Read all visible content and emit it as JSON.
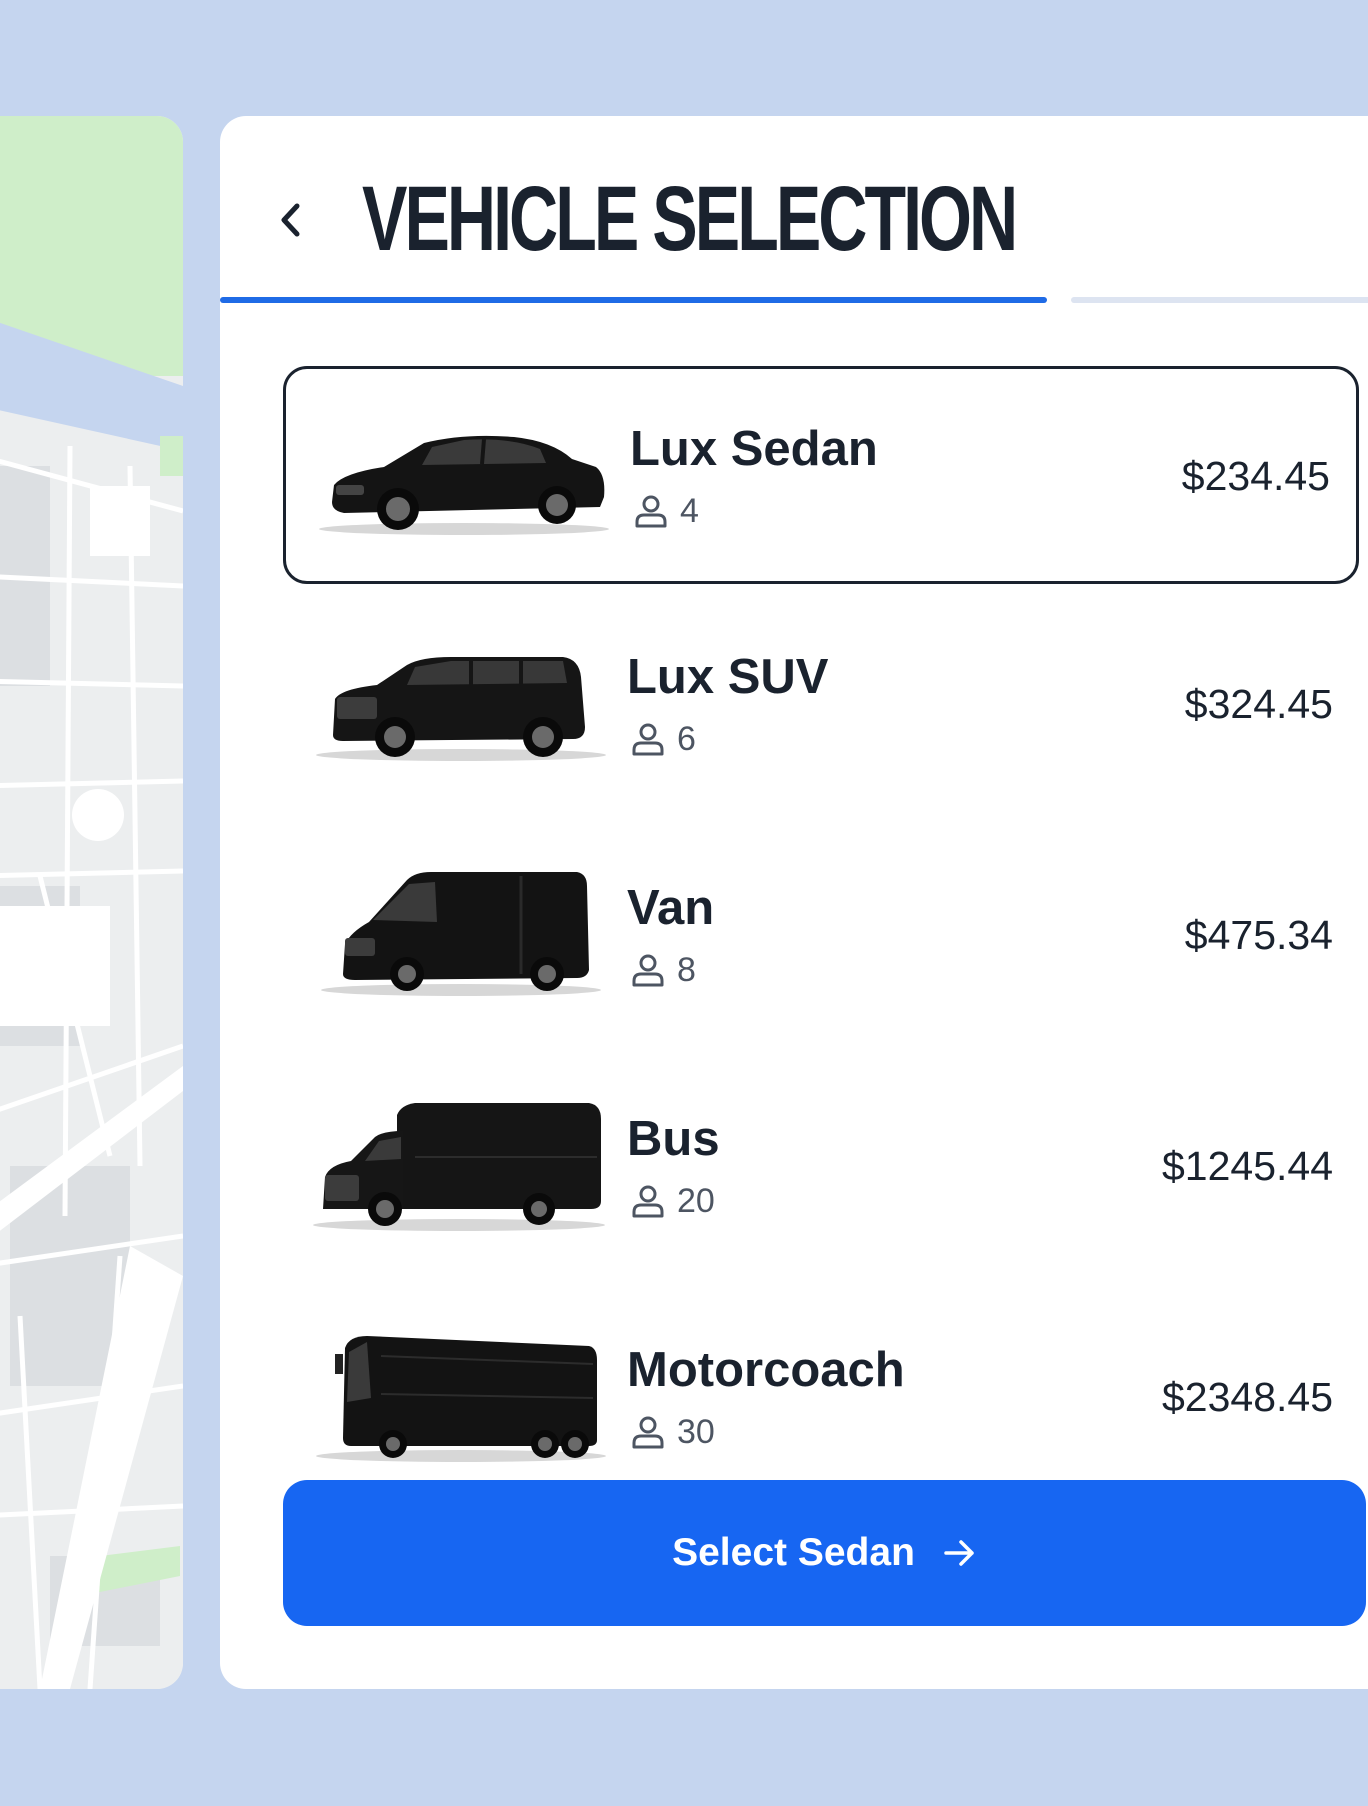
{
  "header": {
    "title": "VEHICLE SELECTION",
    "back_icon": "chevron-left-icon"
  },
  "progress": {
    "current_step": 1,
    "total_steps": 2
  },
  "vehicles": [
    {
      "name": "Lux Sedan",
      "capacity": "4",
      "price": "$234.45",
      "selected": true,
      "icon": "sedan-image"
    },
    {
      "name": "Lux SUV",
      "capacity": "6",
      "price": "$324.45",
      "selected": false,
      "icon": "suv-image"
    },
    {
      "name": "Van",
      "capacity": "8",
      "price": "$475.34",
      "selected": false,
      "icon": "van-image"
    },
    {
      "name": "Bus",
      "capacity": "20",
      "price": "$1245.44",
      "selected": false,
      "icon": "bus-image"
    },
    {
      "name": "Motorcoach",
      "capacity": "30",
      "price": "$2348.45",
      "selected": false,
      "icon": "motorcoach-image"
    }
  ],
  "select_button": {
    "label": "Select Sedan",
    "icon": "arrow-right-icon"
  },
  "colors": {
    "background": "#c5d5ef",
    "accent": "#1766f2",
    "progress": "#1f6be6",
    "text": "#1a222e",
    "map_green": "#cfeec9",
    "map_river": "#c5d5ef"
  }
}
